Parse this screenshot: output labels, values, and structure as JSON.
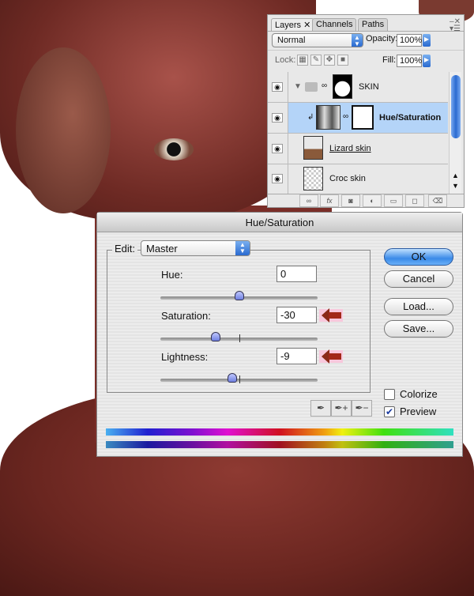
{
  "layers_panel": {
    "tabs": [
      {
        "label": "Layers",
        "active": true
      },
      {
        "label": "Channels"
      },
      {
        "label": "Paths"
      }
    ],
    "blend_mode": "Normal",
    "opacity_label": "Opacity:",
    "opacity_value": "100%",
    "lock_label": "Lock:",
    "fill_label": "Fill:",
    "fill_value": "100%",
    "layers": [
      {
        "name": "SKIN",
        "type": "group"
      },
      {
        "name": "Hue/Saturation",
        "type": "adjustment",
        "selected": true
      },
      {
        "name": "Lizard skin"
      },
      {
        "name": "Croc skin"
      }
    ]
  },
  "dialog": {
    "title": "Hue/Saturation",
    "edit_label": "Edit:",
    "edit_value": "Master",
    "hue_label": "Hue:",
    "hue_value": "0",
    "saturation_label": "Saturation:",
    "saturation_value": "-30",
    "lightness_label": "Lightness:",
    "lightness_value": "-9",
    "sliders": {
      "hue": {
        "min": -180,
        "max": 180,
        "value": 0
      },
      "saturation": {
        "min": -100,
        "max": 100,
        "value": -30
      },
      "lightness": {
        "min": -100,
        "max": 100,
        "value": -9
      }
    },
    "ok_label": "OK",
    "cancel_label": "Cancel",
    "load_label": "Load...",
    "save_label": "Save...",
    "colorize_label": "Colorize",
    "colorize_checked": false,
    "preview_label": "Preview",
    "preview_checked": true,
    "accent_color": "#3a8ae8",
    "arrow_color": "#a22818"
  }
}
